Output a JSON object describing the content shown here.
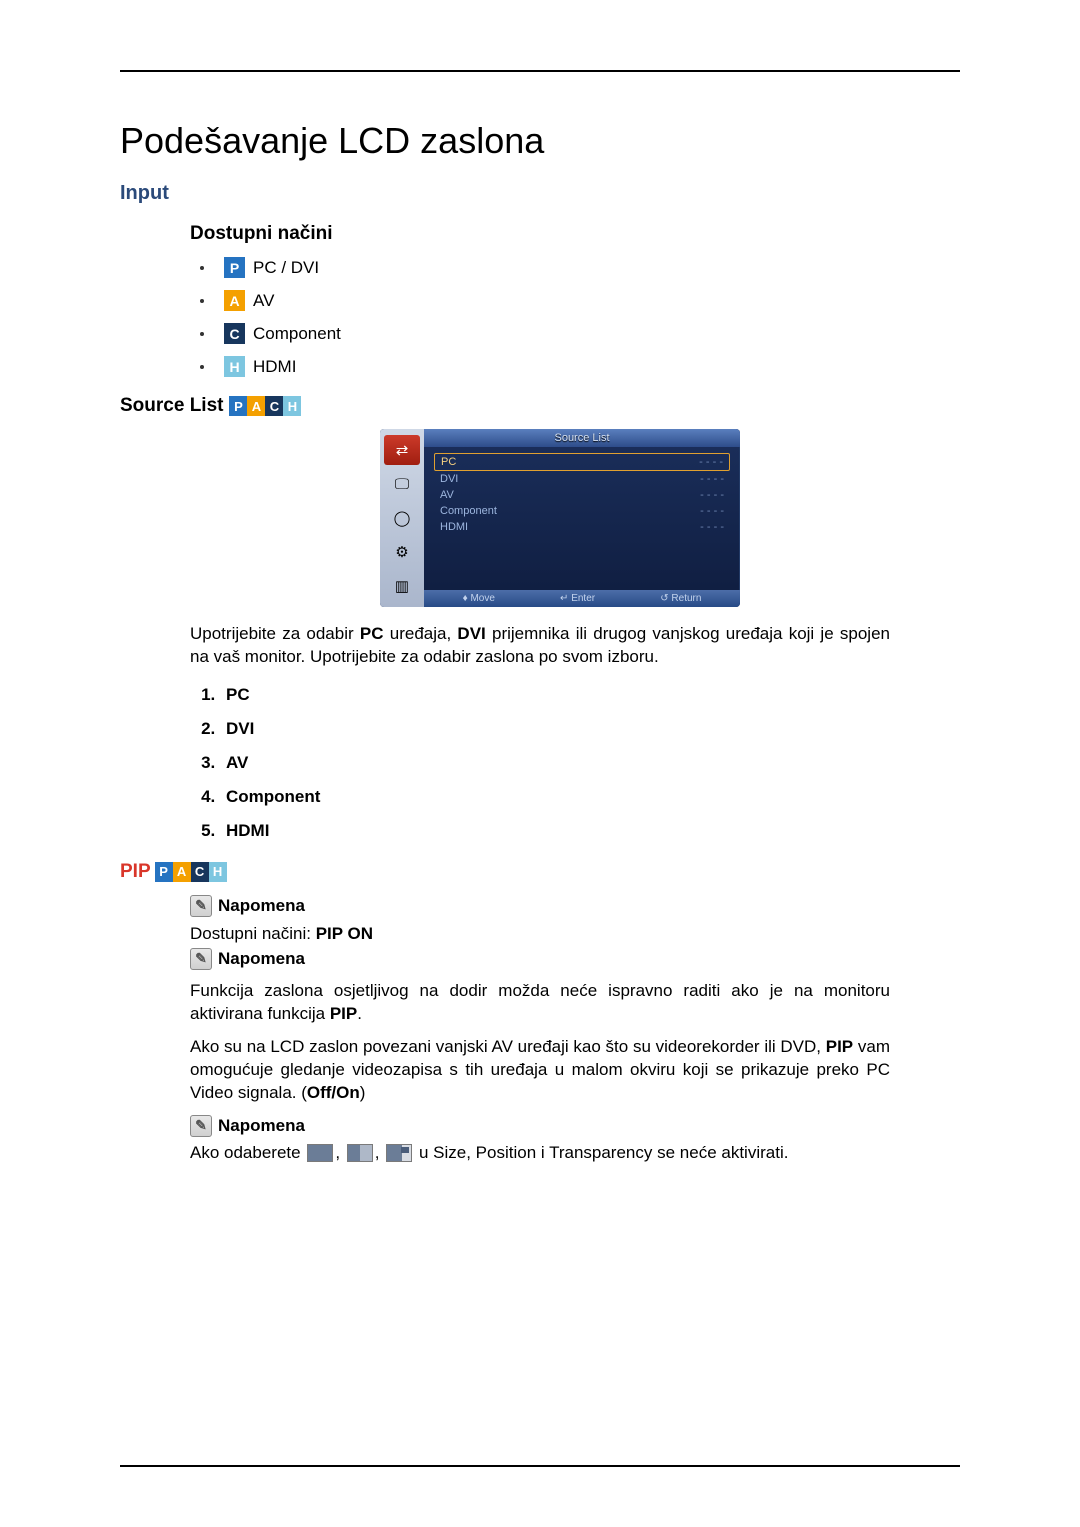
{
  "title": "Podešavanje LCD zaslona",
  "section_input": "Input",
  "modes_heading": "Dostupni načini",
  "modes": [
    {
      "tag": "P",
      "cls": "p",
      "label": "PC / DVI"
    },
    {
      "tag": "A",
      "cls": "a",
      "label": "AV"
    },
    {
      "tag": "C",
      "cls": "c",
      "label": "Component"
    },
    {
      "tag": "H",
      "cls": "h",
      "label": "HDMI"
    }
  ],
  "source_list_heading": "Source List",
  "osd": {
    "title": "Source List",
    "rows": [
      {
        "name": "PC",
        "val": "- - - -",
        "sel": true
      },
      {
        "name": "DVI",
        "val": "- - - -"
      },
      {
        "name": "AV",
        "val": "- - - -"
      },
      {
        "name": "Component",
        "val": "- - - -"
      },
      {
        "name": "HDMI",
        "val": "- - - -"
      }
    ],
    "footer": {
      "move": "Move",
      "enter": "Enter",
      "return": "Return"
    }
  },
  "source_desc_a": "Upotrijebite za odabir ",
  "source_desc_pc": "PC",
  "source_desc_b": " uređaja, ",
  "source_desc_dvi": "DVI",
  "source_desc_c": " prijemnika ili drugog vanjskog uređaja koji je spojen na vaš monitor. Upotrijebite za odabir zaslona po svom izboru.",
  "numbered": [
    "PC",
    "DVI",
    "AV",
    "Component",
    "HDMI"
  ],
  "pip_heading": "PIP",
  "note_label": "Napomena",
  "pip_modes_prefix": "Dostupni načini: ",
  "pip_modes_bold": "PIP ON",
  "pip_warn": "Funkcija zaslona osjetljivog na dodir možda neće ispravno raditi ako je na monitoru aktivirana funkcija ",
  "pip_warn_bold": "PIP",
  "pip_warn_suffix": ".",
  "pip_desc_a": "Ako su na LCD zaslon povezani vanjski AV uređaji kao što su videorekorder ili DVD, ",
  "pip_desc_bold": "PIP",
  "pip_desc_b": " vam omogućuje gledanje videozapisa s tih uređaja u malom okviru koji se prikazuje preko PC Video signala. (",
  "pip_desc_offon": "Off/On",
  "pip_desc_c": ")",
  "last_prefix": "Ako odaberete ",
  "last_mid": " u ",
  "last_size": "Size",
  "last_comma": ", ",
  "last_position": "Position",
  "last_and": " i ",
  "last_transparency": "Transparency",
  "last_suffix": " se neće aktivirati."
}
